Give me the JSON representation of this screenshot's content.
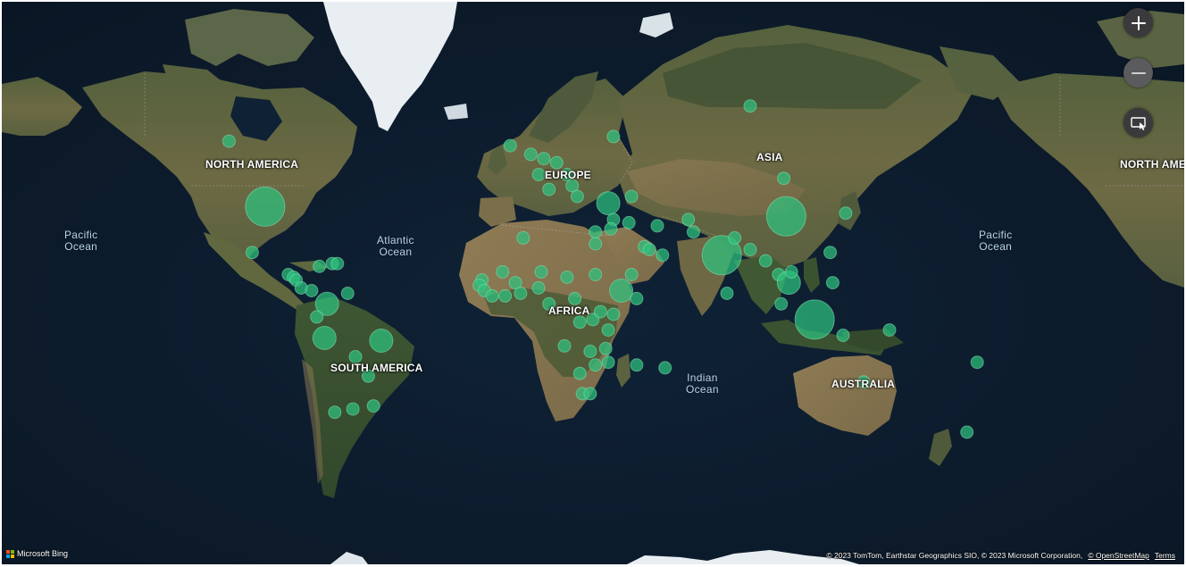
{
  "map": {
    "style": "satellite",
    "provider_logo": "Microsoft Bing",
    "bubble_color": "#2ec27e"
  },
  "continent_labels": [
    {
      "text": "NORTH AMERICA",
      "id": "north-america"
    },
    {
      "text": "EUROPE",
      "id": "europe"
    },
    {
      "text": "ASIA",
      "id": "asia"
    },
    {
      "text": "AFRICA",
      "id": "africa"
    },
    {
      "text": "SOUTH AMERICA",
      "id": "south-america"
    },
    {
      "text": "AUSTRALIA",
      "id": "australia"
    },
    {
      "text": "NORTH AME",
      "id": "north-america-wrap"
    }
  ],
  "ocean_labels": [
    {
      "line1": "Pacific",
      "line2": "Ocean",
      "id": "pacific-west"
    },
    {
      "line1": "Atlantic",
      "line2": "Ocean",
      "id": "atlantic"
    },
    {
      "line1": "Indian",
      "line2": "Ocean",
      "id": "indian"
    },
    {
      "line1": "Pacific",
      "line2": "Ocean",
      "id": "pacific-east"
    }
  ],
  "controls": {
    "zoom_in": "plus-icon",
    "zoom_out": "minus-icon",
    "map_style": "map-style-picker-icon"
  },
  "attribution": {
    "text": "© 2023 TomTom, Earthstar Geographics SIO, © 2023 Microsoft Corporation,",
    "osm": "© OpenStreetMap",
    "terms": "Terms"
  },
  "bubbles": [
    {
      "lon": -112,
      "lat": 55,
      "size": "small"
    },
    {
      "lon": -98,
      "lat": 38,
      "size": "large"
    },
    {
      "lon": -103,
      "lat": 23,
      "size": "small"
    },
    {
      "lon": -89,
      "lat": 15,
      "size": "small"
    },
    {
      "lon": -87,
      "lat": 14,
      "size": "small"
    },
    {
      "lon": -86,
      "lat": 13,
      "size": "small"
    },
    {
      "lon": -84,
      "lat": 10,
      "size": "small"
    },
    {
      "lon": -80,
      "lat": 9,
      "size": "small"
    },
    {
      "lon": -77,
      "lat": 18,
      "size": "small"
    },
    {
      "lon": -72,
      "lat": 19,
      "size": "small"
    },
    {
      "lon": -70,
      "lat": 19,
      "size": "small"
    },
    {
      "lon": -66,
      "lat": 8,
      "size": "small"
    },
    {
      "lon": -74,
      "lat": 4,
      "size": "medium"
    },
    {
      "lon": -78,
      "lat": -1,
      "size": "small"
    },
    {
      "lon": -75,
      "lat": -9,
      "size": "medium"
    },
    {
      "lon": -53,
      "lat": -10,
      "size": "medium"
    },
    {
      "lon": -63,
      "lat": -16,
      "size": "small"
    },
    {
      "lon": -58,
      "lat": -23,
      "size": "small"
    },
    {
      "lon": -71,
      "lat": -35,
      "size": "small"
    },
    {
      "lon": -64,
      "lat": -34,
      "size": "small"
    },
    {
      "lon": -56,
      "lat": -33,
      "size": "small"
    },
    {
      "lon": -3,
      "lat": 54,
      "size": "small"
    },
    {
      "lon": 5,
      "lat": 52,
      "size": "small"
    },
    {
      "lon": 10,
      "lat": 51,
      "size": "small"
    },
    {
      "lon": 8,
      "lat": 47,
      "size": "small"
    },
    {
      "lon": 15,
      "lat": 50,
      "size": "small"
    },
    {
      "lon": 19,
      "lat": 47,
      "size": "small"
    },
    {
      "lon": 12,
      "lat": 43,
      "size": "small"
    },
    {
      "lon": 21,
      "lat": 44,
      "size": "small"
    },
    {
      "lon": 23,
      "lat": 41,
      "size": "small"
    },
    {
      "lon": 35,
      "lat": 39,
      "size": "medium"
    },
    {
      "lon": 44,
      "lat": 41,
      "size": "small"
    },
    {
      "lon": 37,
      "lat": 56,
      "size": "small"
    },
    {
      "lon": 54,
      "lat": 32,
      "size": "small"
    },
    {
      "lon": 66,
      "lat": 34,
      "size": "small"
    },
    {
      "lon": 68,
      "lat": 30,
      "size": "small"
    },
    {
      "lon": 90,
      "lat": 62,
      "size": "small"
    },
    {
      "lon": 103,
      "lat": 46,
      "size": "small"
    },
    {
      "lon": 104,
      "lat": 35,
      "size": "large"
    },
    {
      "lon": 127,
      "lat": 36,
      "size": "small"
    },
    {
      "lon": 79,
      "lat": 22,
      "size": "large"
    },
    {
      "lon": 84,
      "lat": 28,
      "size": "small"
    },
    {
      "lon": 90,
      "lat": 24,
      "size": "small"
    },
    {
      "lon": 81,
      "lat": 8,
      "size": "small"
    },
    {
      "lon": 96,
      "lat": 20,
      "size": "small"
    },
    {
      "lon": 101,
      "lat": 15,
      "size": "small"
    },
    {
      "lon": 105,
      "lat": 12,
      "size": "medium"
    },
    {
      "lon": 106,
      "lat": 16,
      "size": "small"
    },
    {
      "lon": 102,
      "lat": 4,
      "size": "small"
    },
    {
      "lon": 122,
      "lat": 12,
      "size": "small"
    },
    {
      "lon": 121,
      "lat": 23,
      "size": "small"
    },
    {
      "lon": 115,
      "lat": -2,
      "size": "large"
    },
    {
      "lon": 126,
      "lat": -8,
      "size": "small"
    },
    {
      "lon": 144,
      "lat": -6,
      "size": "small"
    },
    {
      "lon": 134,
      "lat": -25,
      "size": "small"
    },
    {
      "lon": 178,
      "lat": -18,
      "size": "small"
    },
    {
      "lon": 174,
      "lat": -41,
      "size": "small"
    },
    {
      "lon": 30,
      "lat": 30,
      "size": "small"
    },
    {
      "lon": 37,
      "lat": 34,
      "size": "small"
    },
    {
      "lon": 36,
      "lat": 31,
      "size": "small"
    },
    {
      "lon": 43,
      "lat": 33,
      "size": "small"
    },
    {
      "lon": 49,
      "lat": 25,
      "size": "small"
    },
    {
      "lon": 51,
      "lat": 24,
      "size": "small"
    },
    {
      "lon": 56,
      "lat": 22,
      "size": "small"
    },
    {
      "lon": 44,
      "lat": 15,
      "size": "small"
    },
    {
      "lon": 2,
      "lat": 28,
      "size": "small"
    },
    {
      "lon": 30,
      "lat": 26,
      "size": "small"
    },
    {
      "lon": -6,
      "lat": 16,
      "size": "small"
    },
    {
      "lon": -14,
      "lat": 13,
      "size": "small"
    },
    {
      "lon": -15,
      "lat": 11,
      "size": "small"
    },
    {
      "lon": -13,
      "lat": 9,
      "size": "small"
    },
    {
      "lon": -10,
      "lat": 7,
      "size": "small"
    },
    {
      "lon": -5,
      "lat": 7,
      "size": "small"
    },
    {
      "lon": -1,
      "lat": 12,
      "size": "small"
    },
    {
      "lon": 1,
      "lat": 8,
      "size": "small"
    },
    {
      "lon": 8,
      "lat": 10,
      "size": "small"
    },
    {
      "lon": 9,
      "lat": 16,
      "size": "small"
    },
    {
      "lon": 12,
      "lat": 4,
      "size": "small"
    },
    {
      "lon": 19,
      "lat": 14,
      "size": "small"
    },
    {
      "lon": 30,
      "lat": 15,
      "size": "small"
    },
    {
      "lon": 40,
      "lat": 9,
      "size": "medium"
    },
    {
      "lon": 46,
      "lat": 6,
      "size": "small"
    },
    {
      "lon": 22,
      "lat": 6,
      "size": "small"
    },
    {
      "lon": 24,
      "lat": -3,
      "size": "small"
    },
    {
      "lon": 29,
      "lat": -2,
      "size": "small"
    },
    {
      "lon": 32,
      "lat": 1,
      "size": "small"
    },
    {
      "lon": 37,
      "lat": 0,
      "size": "small"
    },
    {
      "lon": 35,
      "lat": -6,
      "size": "small"
    },
    {
      "lon": 18,
      "lat": -12,
      "size": "small"
    },
    {
      "lon": 28,
      "lat": -14,
      "size": "small"
    },
    {
      "lon": 34,
      "lat": -13,
      "size": "small"
    },
    {
      "lon": 30,
      "lat": -19,
      "size": "small"
    },
    {
      "lon": 35,
      "lat": -18,
      "size": "small"
    },
    {
      "lon": 24,
      "lat": -22,
      "size": "small"
    },
    {
      "lon": 25,
      "lat": -29,
      "size": "small"
    },
    {
      "lon": 28,
      "lat": -29,
      "size": "small"
    },
    {
      "lon": 46,
      "lat": -19,
      "size": "small"
    },
    {
      "lon": 57,
      "lat": -20,
      "size": "small"
    }
  ]
}
